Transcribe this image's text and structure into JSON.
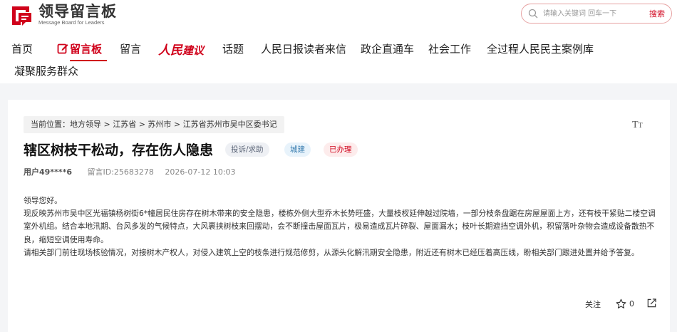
{
  "header": {
    "logo_cn": "领导留言板",
    "logo_en": "Message Board for Leaders",
    "brand_color": "#d0021b"
  },
  "search": {
    "placeholder": "请输入关键词 回车一下",
    "button_label": "搜索"
  },
  "nav": {
    "items": [
      {
        "label": "首页"
      },
      {
        "label": "留言板",
        "active": true,
        "icon": "edit-icon"
      },
      {
        "label": "留言"
      },
      {
        "label_ren": "人民",
        "label": "建议",
        "brand": true
      },
      {
        "label": "话题"
      },
      {
        "label": "人民日报读者来信"
      },
      {
        "label": "政企直通车"
      },
      {
        "label": "社会工作"
      },
      {
        "label": "全过程人民民主案例库"
      },
      {
        "label": "凝聚服务群众"
      }
    ]
  },
  "post": {
    "breadcrumb": "当前位置：地方领导 > 江苏省 > 苏州市 > 江苏省苏州市吴中区委书记",
    "font_size_icon": "text-size-icon",
    "title": "辖区树枝干松动，存在伤人隐患",
    "tags": {
      "type": "投诉/求助",
      "field": "城建",
      "status": "已办理"
    },
    "user": "用户49****6",
    "message_id": "留言ID:25683278",
    "datetime": "2026-07-12 10:03",
    "paragraphs": [
      "领导您好。",
      "现反映苏州市吴中区光福镇杨树街6*幢居民住房存在树木带来的安全隐患，楼栋外侧大型乔木长势旺盛，大量枝杈延伸越过院墙，一部分枝条盘踞在房屋屋面上方，还有枝干紧贴二楼空调室外机组。结合本地汛期、台风多发的气候特点，大风裹挟树枝来回摆动，会不断撞击屋面瓦片，极易造成瓦片碎裂、屋面漏水；枝叶长期遮挡空调外机，积留落叶杂物会造成设备散热不良，缩短空调使用寿命。",
      "请相关部门前往现场核验情况，对接树木产权人，对侵入建筑上空的枝条进行规范修剪，从源头化解汛期安全隐患，附近还有树木已经压着高压线，盼相关部门跟进处置并给予答复。"
    ],
    "actions": {
      "follow_label": "关注",
      "star_count": "0"
    }
  }
}
